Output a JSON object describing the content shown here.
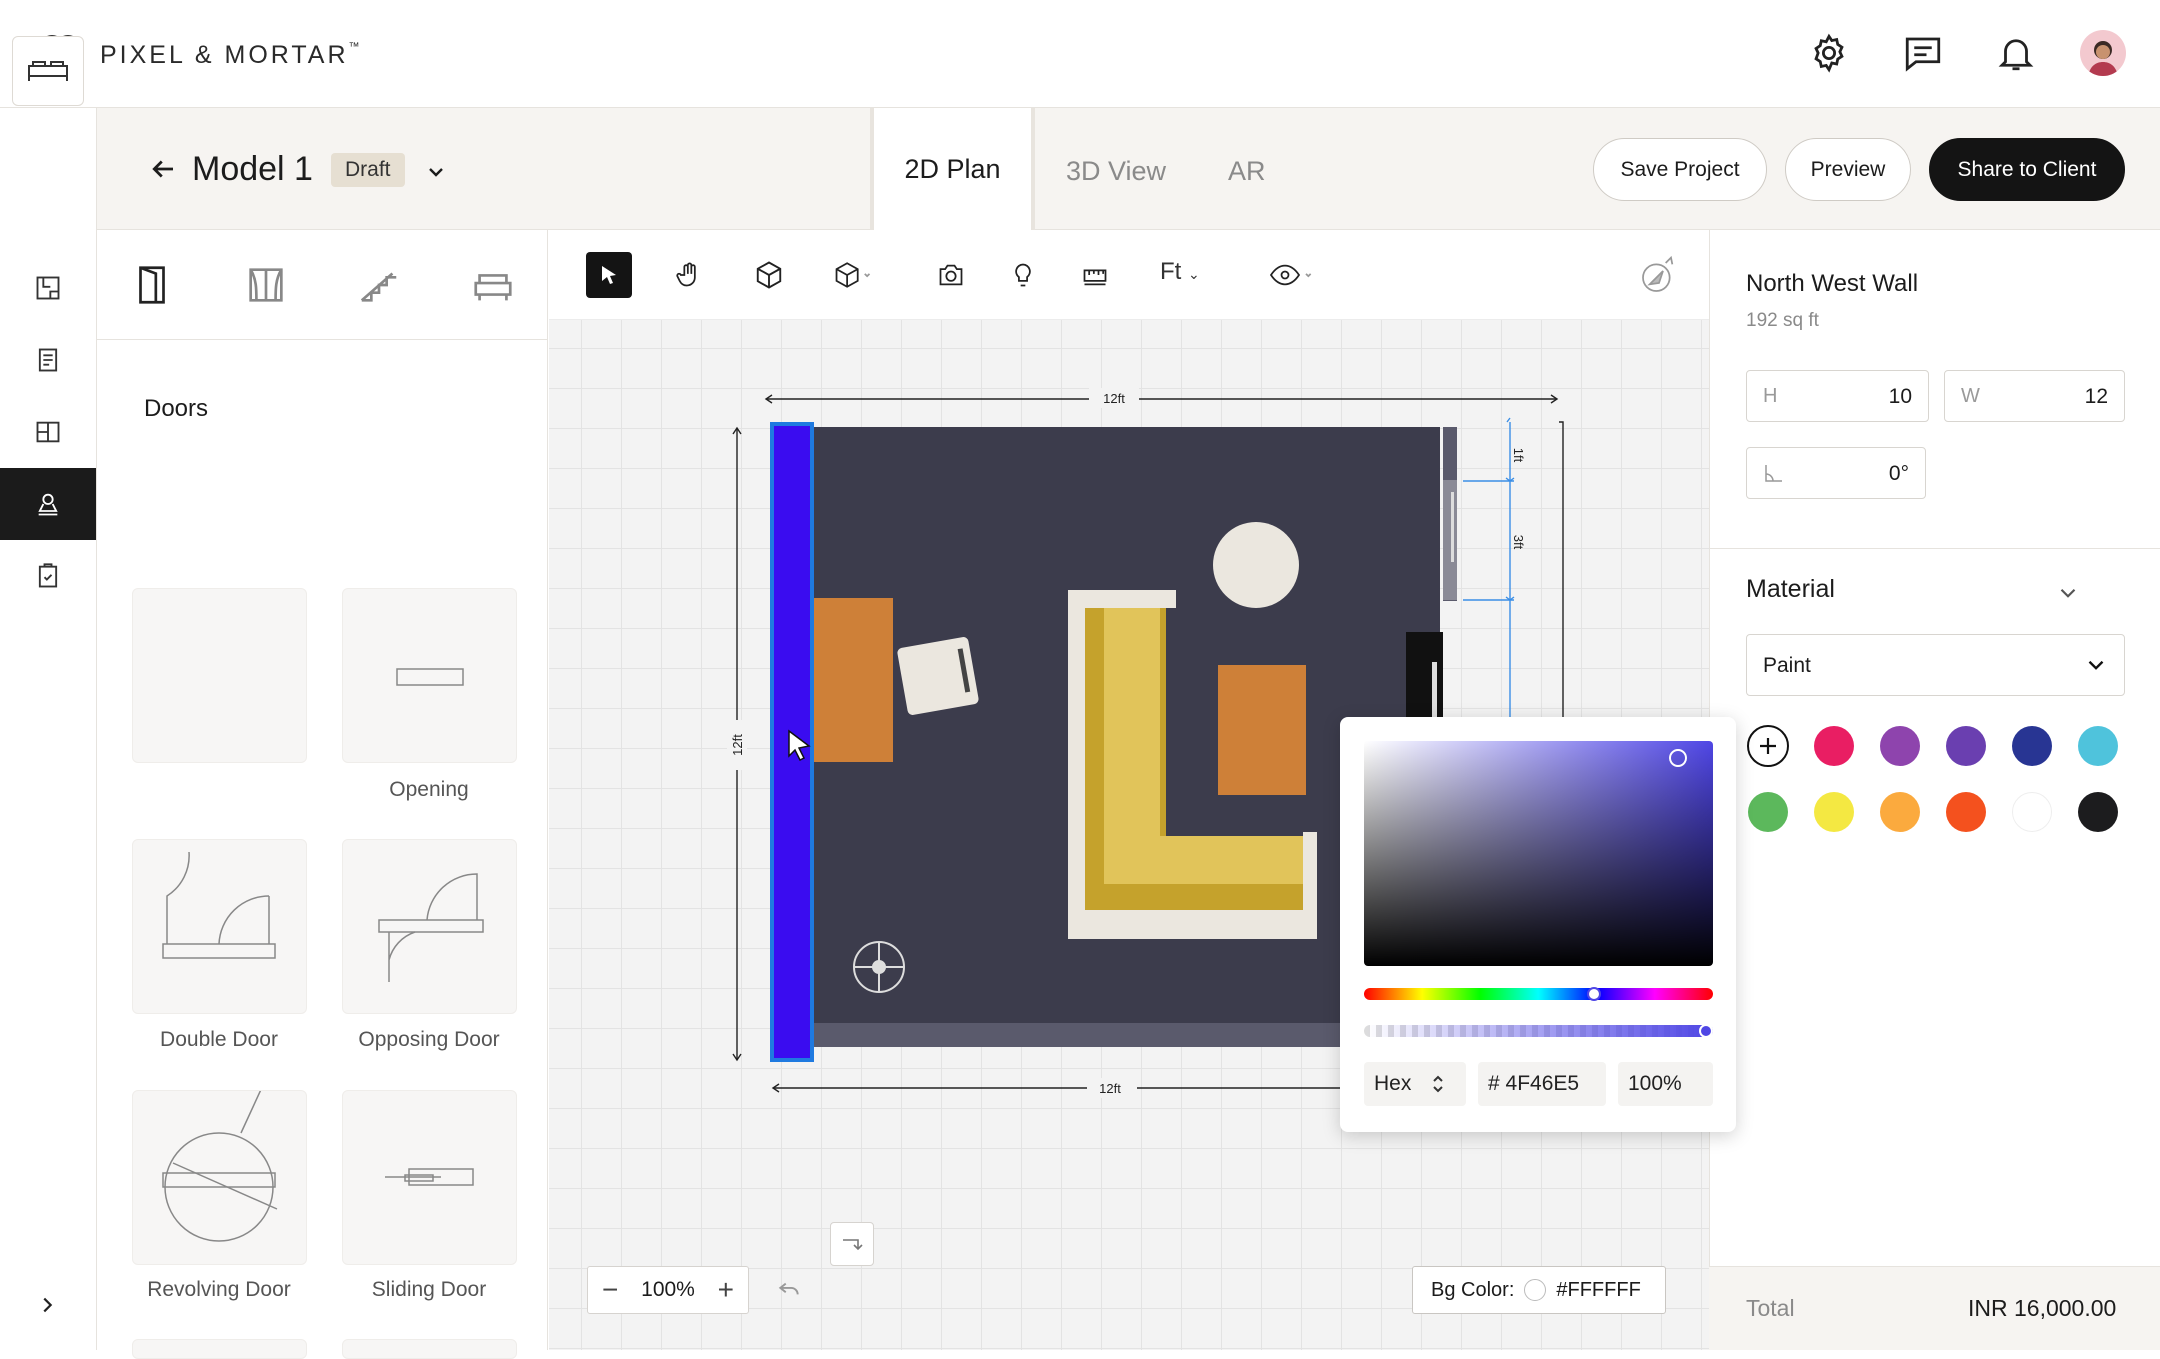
{
  "brand": {
    "name": "PIXEL & MORTAR",
    "tm": "™"
  },
  "header": {
    "icons": [
      "settings-icon",
      "chat-icon",
      "bell-icon"
    ],
    "model_title": "Model 1",
    "status_badge": "Draft",
    "tabs": [
      {
        "label": "2D Plan",
        "active": true
      },
      {
        "label": "3D View",
        "active": false
      },
      {
        "label": "AR",
        "active": false
      }
    ],
    "save_label": "Save Project",
    "preview_label": "Preview",
    "share_label": "Share to Client"
  },
  "rail": {
    "items": [
      "floorplan-icon",
      "catalog-icon",
      "layout-icon",
      "user-pin-icon",
      "clipboard-icon"
    ],
    "active": "user-pin-icon"
  },
  "catalog": {
    "section_title": "Doors",
    "items": [
      {
        "label": ""
      },
      {
        "label": "Opening"
      },
      {
        "label": "Double Door"
      },
      {
        "label": "Opposing Door"
      },
      {
        "label": "Revolving Door"
      },
      {
        "label": "Sliding Door"
      }
    ]
  },
  "toolbar": {
    "unit": "Ft"
  },
  "plan": {
    "dim_top": "12ft",
    "dim_bottom": "12ft",
    "dim_left": "12ft",
    "dim_right_1": "1ft",
    "dim_right_2": "3ft",
    "selected_wall_color": "#3A0CF0",
    "floor_color": "#3C3C4C"
  },
  "zoom": {
    "value": "100%"
  },
  "bg": {
    "label": "Bg Color:",
    "value": "#FFFFFF"
  },
  "inspector": {
    "wall_name": "North West Wall",
    "area": "192 sq ft",
    "height_label": "H",
    "height_value": "10",
    "width_label": "W",
    "width_value": "12",
    "angle_value": "0°",
    "material_title": "Material",
    "material_value": "Paint",
    "swatches": [
      "#E91E63",
      "#8E44AD",
      "#6A3FB0",
      "#283593",
      "#4FC3DC",
      "#5CB85C",
      "#F4E842",
      "#FBAA3E",
      "#F4511E",
      "#FFFFFF",
      "#1C1C1E"
    ],
    "total_label": "Total",
    "total_value": "INR 16,000.00"
  },
  "picker": {
    "format": "Hex",
    "hex": "# 4F46E5",
    "alpha": "100%",
    "hue_position": 0.66,
    "alpha_position": 1.0
  }
}
